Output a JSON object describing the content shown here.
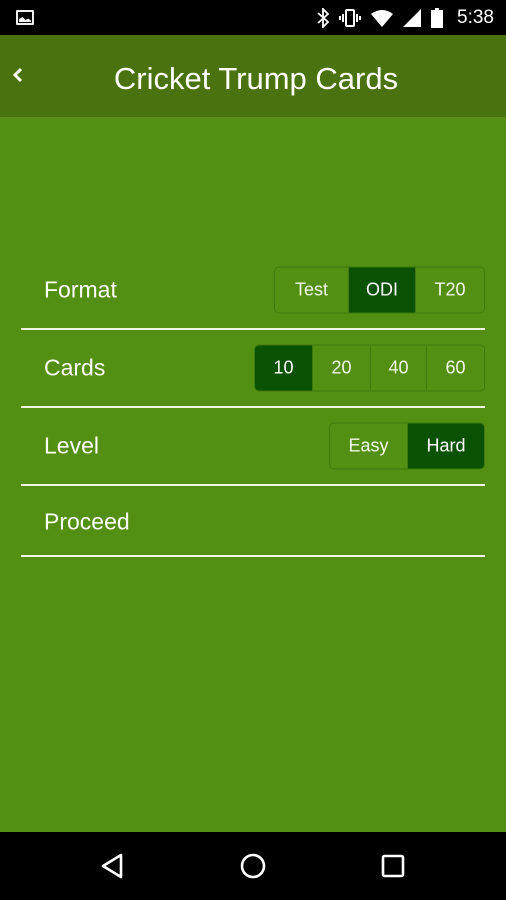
{
  "status_bar": {
    "time": "5:38",
    "icons": [
      "image-notification-icon",
      "bluetooth-icon",
      "vibrate-icon",
      "wifi-icon",
      "cell-signal-icon",
      "battery-icon"
    ]
  },
  "app_bar": {
    "title": "Cricket Trump Cards",
    "back_icon": "chevron-left-icon"
  },
  "settings": {
    "format": {
      "label": "Format",
      "options": [
        "Test",
        "ODI",
        "T20"
      ],
      "selected": "ODI"
    },
    "cards": {
      "label": "Cards",
      "options": [
        "10",
        "20",
        "40",
        "60"
      ],
      "selected": "10"
    },
    "level": {
      "label": "Level",
      "options": [
        "Easy",
        "Hard"
      ],
      "selected": "Hard"
    },
    "proceed": {
      "label": "Proceed"
    }
  },
  "nav_bar": {
    "buttons": [
      "back-triangle-icon",
      "home-circle-icon",
      "recents-square-icon"
    ]
  },
  "colors": {
    "app_bar": "#4a720e",
    "background": "#528f12",
    "selected_segment": "#0a5202"
  }
}
